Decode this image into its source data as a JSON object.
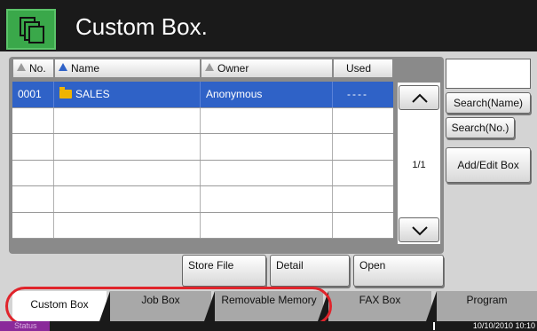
{
  "header": {
    "title": "Custom Box.",
    "icon": "document-box-icon"
  },
  "table": {
    "columns": [
      {
        "label": "No.",
        "sort_indicator": "gray"
      },
      {
        "label": "Name",
        "sort_indicator": "blue"
      },
      {
        "label": "Owner",
        "sort_indicator": "gray"
      },
      {
        "label": "Used"
      }
    ],
    "rows": [
      {
        "no": "0001",
        "name": "SALES",
        "owner": "Anonymous",
        "used": "----",
        "selected": true
      },
      {
        "no": "",
        "name": "",
        "owner": "",
        "used": ""
      },
      {
        "no": "",
        "name": "",
        "owner": "",
        "used": ""
      },
      {
        "no": "",
        "name": "",
        "owner": "",
        "used": ""
      },
      {
        "no": "",
        "name": "",
        "owner": "",
        "used": ""
      },
      {
        "no": "",
        "name": "",
        "owner": "",
        "used": ""
      }
    ],
    "page_indicator": "1/1"
  },
  "search": {
    "value": ""
  },
  "side_buttons": {
    "search_name": "Search(Name)",
    "search_no": "Search(No.)",
    "add_edit": "Add/Edit Box"
  },
  "actions": {
    "store_file": "Store File",
    "detail": "Detail",
    "open": "Open"
  },
  "tabs": [
    {
      "label": "Custom Box",
      "active": true
    },
    {
      "label": "Job Box"
    },
    {
      "label": "Removable Memory"
    },
    {
      "label": "FAX Box"
    },
    {
      "label": "Program"
    }
  ],
  "status_bar": {
    "status_label": "Status",
    "datetime": "10/10/2010 10:10"
  },
  "colors": {
    "selection": "#2f62c7",
    "header_icon": "#3aa84a",
    "highlight": "#e0242b",
    "status": "#8a2a9a"
  }
}
